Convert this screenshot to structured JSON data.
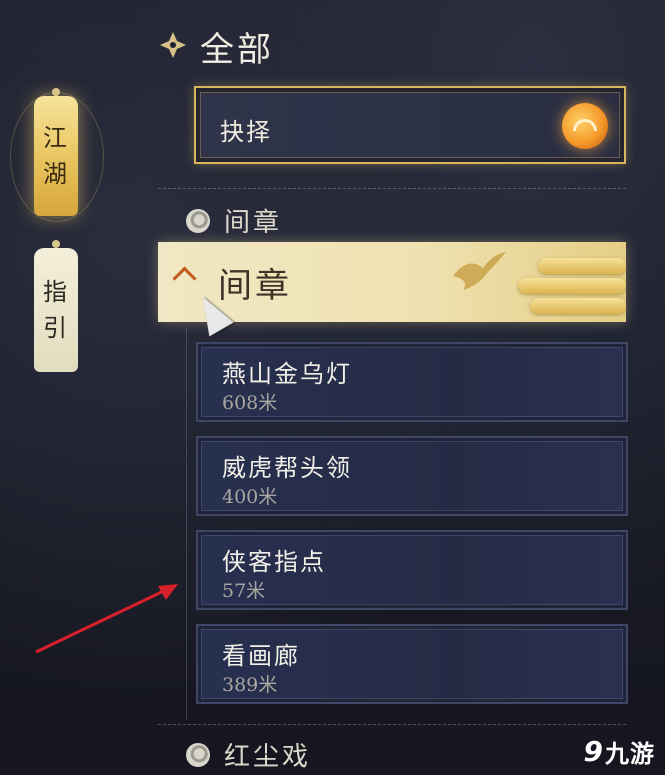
{
  "side_tabs": [
    {
      "label": "江湖",
      "chars": [
        "江",
        "湖"
      ],
      "active": true
    },
    {
      "label": "指引",
      "chars": [
        "指",
        "引"
      ],
      "active": false
    }
  ],
  "header": {
    "title": "全部"
  },
  "selected": {
    "label": "抉择"
  },
  "sections": {
    "collapsed_top": "间章",
    "expanded": "间章",
    "collapsed_bottom": "红尘戏"
  },
  "quests": [
    {
      "name": "燕山金乌灯",
      "distance": "608米"
    },
    {
      "name": "威虎帮头领",
      "distance": "400米"
    },
    {
      "name": "侠客指点",
      "distance": "57米"
    },
    {
      "name": "看画廊",
      "distance": "389米"
    }
  ],
  "watermark": {
    "mark": "9",
    "text": "九游"
  },
  "colors": {
    "accent_gold": "#d8b45a",
    "annotation_red": "#d8202a",
    "orb_orange": "#f59a2a"
  }
}
